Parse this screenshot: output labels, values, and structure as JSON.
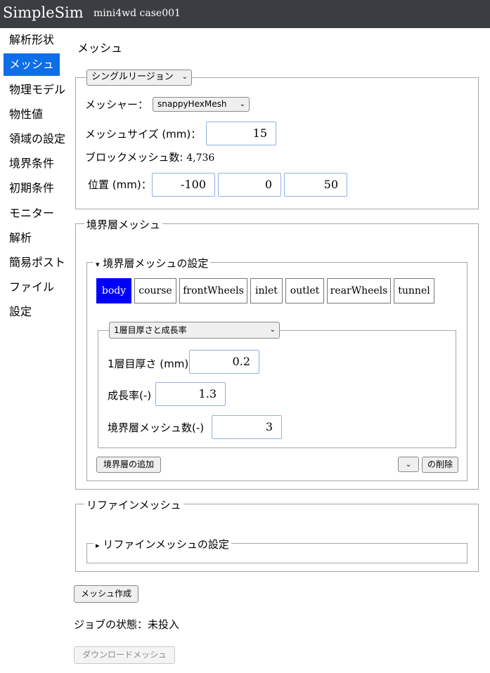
{
  "header": {
    "app_title": "SimpleSim",
    "case_name": "mini4wd case001"
  },
  "sidebar": {
    "items": [
      {
        "label": "解析形状",
        "active": false
      },
      {
        "label": "メッシュ",
        "active": true
      },
      {
        "label": "物理モデル",
        "active": false
      },
      {
        "label": "物性値",
        "active": false
      },
      {
        "label": "領域の設定",
        "active": false
      },
      {
        "label": "境界条件",
        "active": false
      },
      {
        "label": "初期条件",
        "active": false
      },
      {
        "label": "モニター",
        "active": false
      },
      {
        "label": "解析",
        "active": false
      },
      {
        "label": "簡易ポスト",
        "active": false
      },
      {
        "label": "ファイル",
        "active": false
      },
      {
        "label": "設定",
        "active": false
      }
    ]
  },
  "main": {
    "page_title": "メッシュ",
    "region": {
      "mode_select": "シングルリージョン",
      "mesher_label": "メッシャー：",
      "mesher_value": "snappyHexMesh",
      "mesh_size_label": "メッシュサイズ (mm)：",
      "mesh_size_value": "15",
      "block_count_label": "ブロックメッシュ数:",
      "block_count_value": "4,736",
      "position_label": "位置 (mm)：",
      "position": {
        "x": "-100",
        "y": "0",
        "z": "50"
      }
    },
    "boundary_layer": {
      "legend": "境界層メッシュ",
      "settings_toggle": "▾",
      "settings_label": "境界層メッシュの設定",
      "tabs": [
        "body",
        "course",
        "frontWheels",
        "inlet",
        "outlet",
        "rearWheels",
        "tunnel"
      ],
      "active_tab": "body",
      "layer_mode_select": "1層目厚さと成長率",
      "first_layer_label": "1層目厚さ (mm)",
      "first_layer_value": "0.2",
      "growth_rate_label": "成長率(-)",
      "growth_rate_value": "1.3",
      "layer_count_label": "境界層メッシュ数(-)",
      "layer_count_value": "3",
      "add_button": "境界層の追加",
      "delete_button": "の削除"
    },
    "refine": {
      "legend": "リファインメッシュ",
      "settings_toggle": "▸",
      "settings_label": "リファインメッシュの設定"
    },
    "create_button": "メッシュ作成",
    "job_status_label": "ジョブの状態：",
    "job_status_value": "未投入",
    "download_button": "ダウンロードメッシュ"
  },
  "colors": {
    "header_bg": "#3a3d42",
    "nav_active": "#0d6ee6",
    "tab_active": "#0000ff",
    "input_border": "#8fb3e0"
  }
}
